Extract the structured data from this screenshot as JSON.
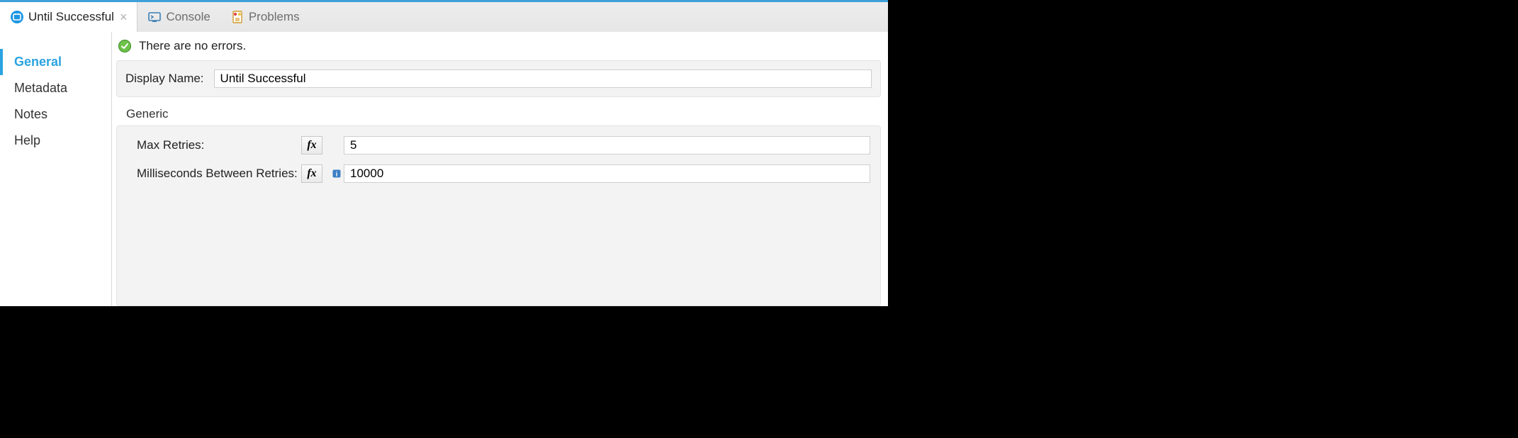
{
  "tabs": {
    "active": {
      "label": "Until Successful"
    },
    "console": {
      "label": "Console"
    },
    "problems": {
      "label": "Problems"
    }
  },
  "sidebar": {
    "items": [
      {
        "label": "General",
        "active": true
      },
      {
        "label": "Metadata"
      },
      {
        "label": "Notes"
      },
      {
        "label": "Help"
      }
    ]
  },
  "status": {
    "text": "There are no errors."
  },
  "display_name": {
    "label": "Display Name:",
    "value": "Until Successful"
  },
  "section": {
    "title": "Generic",
    "max_retries": {
      "label": "Max Retries:",
      "value": "5"
    },
    "ms_between": {
      "label": "Milliseconds Between Retries:",
      "value": "10000"
    }
  },
  "colors": {
    "accent": "#2aa3e0"
  }
}
